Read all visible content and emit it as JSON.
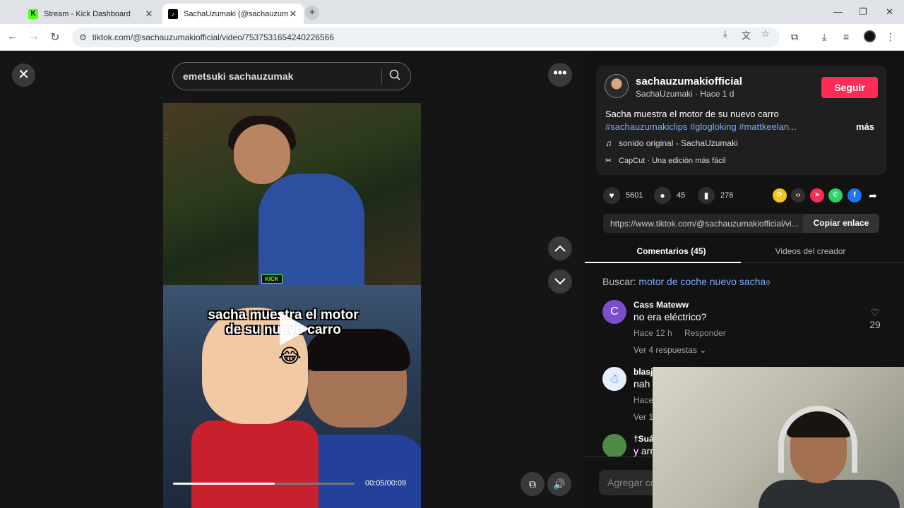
{
  "browser": {
    "tabs": [
      {
        "title": "Stream - Kick Dashboard"
      },
      {
        "title": "SachaUzumaki (@sachauzumakiofficial) | TikTok"
      }
    ],
    "url": "tiktok.com/@sachauzumakiofficial/video/7537531654240226566"
  },
  "search": {
    "query": "emetsuki sachauzumak"
  },
  "video": {
    "caption_line1": "sacha muestra el motor",
    "caption_line2": "de su nuevo carro",
    "badge": "KICK",
    "progress": 0.56,
    "time": "00:05/00:09"
  },
  "post": {
    "username": "sachauzumakiofficial",
    "subtitle": "SachaUzumaki · Hace 1 d",
    "follow_label": "Seguir",
    "description": "Sacha muestra el motor de su nuevo carro",
    "hashtags": "#sachauzumakiclips #glogloking #mattkeelan...",
    "more_label": "más",
    "sound": "sonido original - SachaUzumaki",
    "capcut": "CapCut · Una edición más fácil",
    "likes": "5601",
    "comments": "45",
    "saves": "276",
    "link_url": "https://www.tiktok.com/@sachauzumakiofficial/vi...",
    "copy_label": "Copiar enlace"
  },
  "panel_tabs": {
    "comments": "Comentarios (45)",
    "videos": "Videos del creador"
  },
  "search_suggestion": {
    "label": "Buscar:",
    "query": "motor de coche nuevo sacha"
  },
  "comments": [
    {
      "avatar_letter": "C",
      "avatar_color": "#7b4fc9",
      "name": "Cass Mateww",
      "text": "no era eléctrico?",
      "time": "Hace 12 h",
      "reply": "Responder",
      "replies": "Ver 4 respuestas",
      "likes": "29"
    },
    {
      "avatar_letter": "",
      "avatar_color": "#3c7bd6",
      "name": "blasj",
      "text": "nah",
      "time": "Hace",
      "replies": "Ver 1"
    },
    {
      "avatar_letter": "",
      "avatar_color": "#4e8a46",
      "name": "†Suá",
      "text": "y arr"
    }
  ],
  "add_comment_placeholder": "Agregar co"
}
